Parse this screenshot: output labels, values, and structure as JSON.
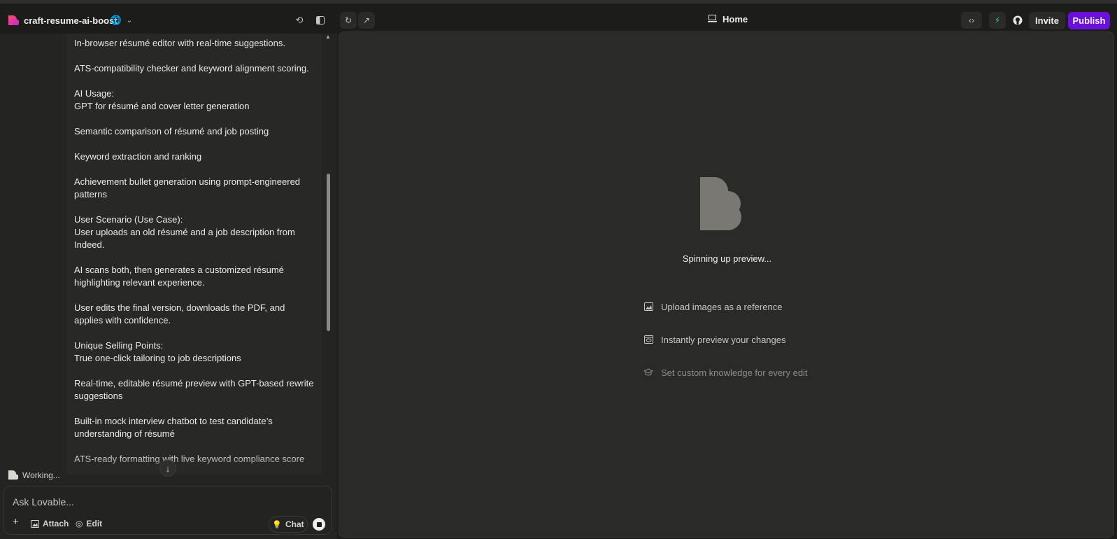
{
  "topbar": {
    "project_name": "craft-resume-ai-boost",
    "route": "Home",
    "invite_label": "Invite",
    "publish_label": "Publish",
    "publish_color": "#6b10d8"
  },
  "chat": {
    "paragraphs": [
      "In-browser résumé editor with real-time suggestions.",
      "ATS-compatibility checker and keyword alignment scoring.",
      "AI Usage:\nGPT for résumé and cover letter generation",
      "Semantic comparison of résumé and job posting",
      "Keyword extraction and ranking",
      "Achievement bullet generation using prompt-engineered patterns",
      "User Scenario (Use Case):\nUser uploads an old résumé and a job description from Indeed.",
      "AI scans both, then generates a customized résumé highlighting relevant experience.",
      "User edits the final version, downloads the PDF, and applies with confidence.",
      "Unique Selling Points:\nTrue one-click tailoring to job descriptions",
      "Real-time, editable résumé preview with GPT-based rewrite suggestions",
      "Built-in mock interview chatbot to test candidate’s understanding of résumé",
      "ATS-ready formatting with live keyword compliance score"
    ],
    "status": "Working...",
    "input_placeholder": "Ask Lovable...",
    "attach_label": "Attach",
    "edit_label": "Edit",
    "chat_label": "Chat"
  },
  "preview": {
    "status": "Spinning up preview...",
    "tips": [
      {
        "icon": "image-icon",
        "label": "Upload images as a reference"
      },
      {
        "icon": "eye-icon",
        "label": "Instantly preview your changes"
      },
      {
        "icon": "graduation-cap-icon",
        "label": "Set custom knowledge for every edit"
      }
    ]
  },
  "icons": {
    "topbar": [
      "lovable-logo-icon",
      "globe-icon",
      "chevron-down-icon",
      "history-icon",
      "sidebar-toggle-icon",
      "refresh-icon",
      "external-link-icon",
      "laptop-icon",
      "code-icon",
      "supabase-icon",
      "github-icon"
    ],
    "chat": [
      "scroll-up-icon",
      "arrow-down-icon",
      "lovable-mini-icon",
      "plus-icon",
      "image-icon",
      "target-icon",
      "lightbulb-icon",
      "stop-icon"
    ]
  }
}
